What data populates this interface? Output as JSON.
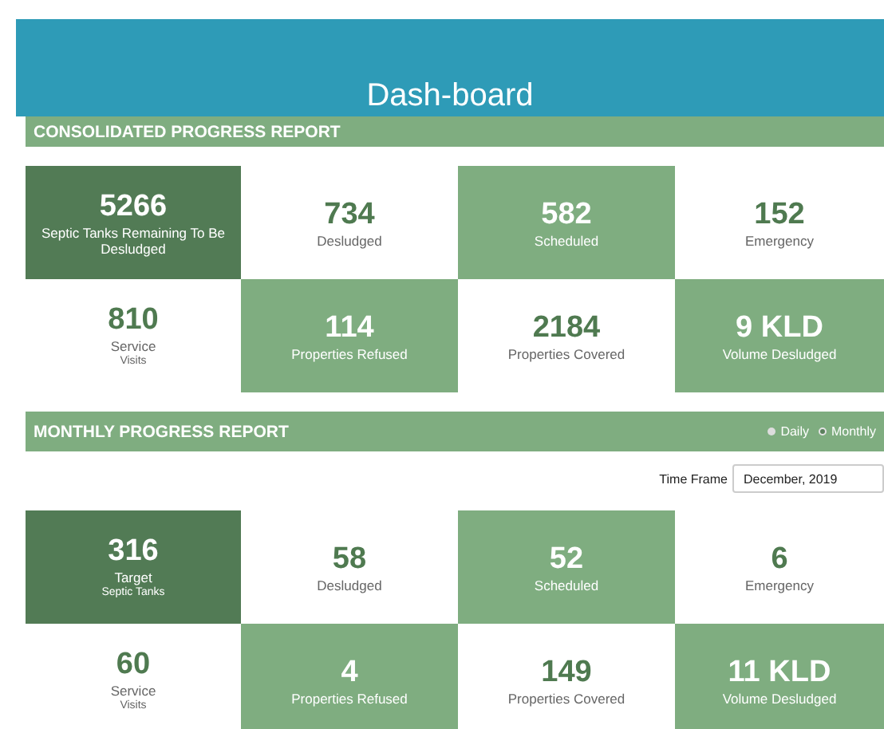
{
  "header": {
    "title": "Dash-board"
  },
  "consolidated": {
    "title": "CONSOLIDATED PROGRESS REPORT",
    "tiles": [
      {
        "value": "5266",
        "label": "Septic Tanks Remaining To Be Desludged",
        "kind": "dark"
      },
      {
        "value": "734",
        "label": "Desludged",
        "kind": "plain"
      },
      {
        "value": "582",
        "label": "Scheduled",
        "kind": "light"
      },
      {
        "value": "152",
        "label": "Emergency",
        "kind": "plain"
      },
      {
        "value": "810",
        "label": "Service",
        "sublabel": "Visits",
        "kind": "plain"
      },
      {
        "value": "114",
        "label": "Properties Refused",
        "kind": "light"
      },
      {
        "value": "2184",
        "label": "Properties Covered",
        "kind": "plain"
      },
      {
        "value": "9 KLD",
        "label": "Volume Desludged",
        "kind": "light"
      }
    ]
  },
  "monthly": {
    "title": "MONTHLY PROGRESS REPORT",
    "options": [
      {
        "label": "Daily",
        "selected": false
      },
      {
        "label": "Monthly",
        "selected": true
      }
    ],
    "time_frame": {
      "label": "Time Frame",
      "value": "December, 2019"
    },
    "tiles": [
      {
        "value": "316",
        "label": "Target",
        "sublabel": "Septic Tanks",
        "kind": "dark"
      },
      {
        "value": "58",
        "label": "Desludged",
        "kind": "plain"
      },
      {
        "value": "52",
        "label": "Scheduled",
        "kind": "light"
      },
      {
        "value": "6",
        "label": "Emergency",
        "kind": "plain"
      },
      {
        "value": "60",
        "label": "Service",
        "sublabel": "Visits",
        "kind": "plain"
      },
      {
        "value": "4",
        "label": "Properties Refused",
        "kind": "light"
      },
      {
        "value": "149",
        "label": "Properties Covered",
        "kind": "plain"
      },
      {
        "value": "11 KLD",
        "label": "Volume Desludged",
        "kind": "light"
      }
    ]
  }
}
